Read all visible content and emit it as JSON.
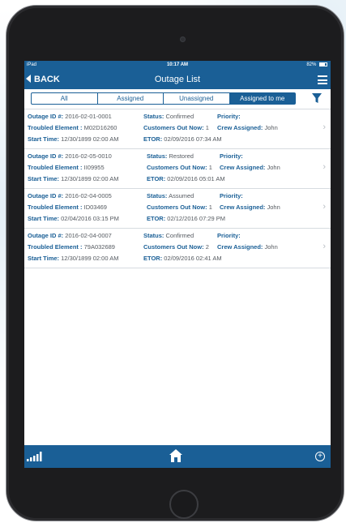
{
  "status_bar": {
    "carrier": "iPad",
    "time": "10:17 AM",
    "battery": "82%"
  },
  "nav": {
    "back_label": "BACK",
    "title": "Outage List"
  },
  "segments": [
    "All",
    "Assigned",
    "Unassigned",
    "Assigned to me"
  ],
  "active_segment": "Assigned to me",
  "labels": {
    "outage_id": "Outage ID #:",
    "troubled_element": "Troubled Element :",
    "start_time": "Start Time:",
    "status": "Status:",
    "customers_out": "Customers Out Now:",
    "etor": "ETOR:",
    "priority": "Priority:",
    "crew": "Crew Assigned:"
  },
  "outages": [
    {
      "id": "2016-02-01-0001",
      "element": "M02D16260",
      "start": "12/30/1899 02:00 AM",
      "status": "Confirmed",
      "customers": "1",
      "etor": "02/09/2016 07:34 AM",
      "priority": "",
      "crew": "John"
    },
    {
      "id": "2016-02-05-0010",
      "element": "II09955",
      "start": "12/30/1899 02:00 AM",
      "status": "Restored",
      "customers": "1",
      "etor": "02/09/2016 05:01 AM",
      "priority": "",
      "crew": "John"
    },
    {
      "id": "2016-02-04-0005",
      "element": "ID03469",
      "start": "02/04/2016 03:15 PM",
      "status": "Assumed",
      "customers": "1",
      "etor": "02/12/2016 07:29 PM",
      "priority": "",
      "crew": "John"
    },
    {
      "id": "2016-02-04-0007",
      "element": "79A032689",
      "start": "12/30/1899 02:00 AM",
      "status": "Confirmed",
      "customers": "2",
      "etor": "02/09/2016 02:41 AM",
      "priority": "",
      "crew": "John"
    }
  ],
  "icons": {
    "back": "back-arrow-icon",
    "menu": "hamburger-menu-icon",
    "filter": "filter-funnel-icon",
    "signal": "signal-bars-icon",
    "home": "home-icon",
    "add": "plus-circle-icon",
    "chevron": "chevron-right-icon"
  },
  "colors": {
    "brand": "#1a5f96",
    "row_divider": "#d6dbe0",
    "value_text": "#555a60"
  }
}
